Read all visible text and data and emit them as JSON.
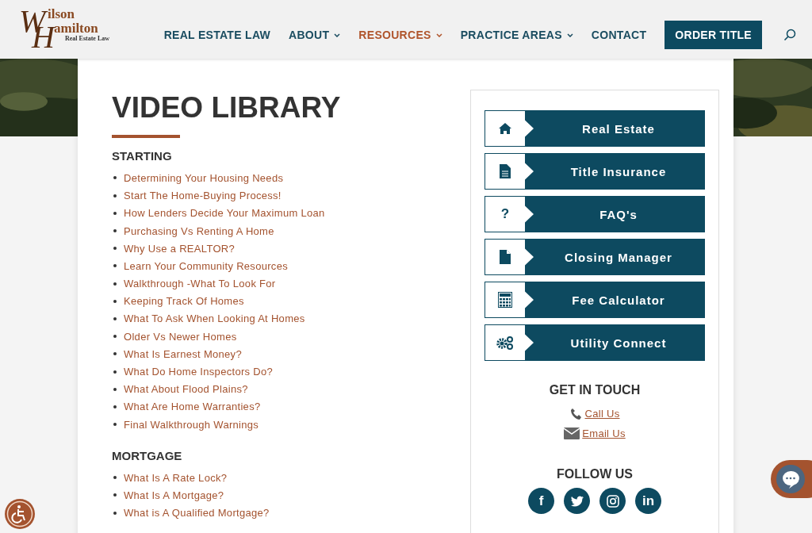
{
  "logo": {
    "initial_1": "W",
    "line_1": "ilson",
    "initial_2": "H",
    "line_2": "amilton",
    "tagline": "Real Estate Law"
  },
  "nav": [
    {
      "label": "REAL ESTATE LAW",
      "dropdown": false,
      "selected": false
    },
    {
      "label": "ABOUT",
      "dropdown": true,
      "selected": false
    },
    {
      "label": "RESOURCES",
      "dropdown": true,
      "selected": true
    },
    {
      "label": "PRACTICE AREAS",
      "dropdown": true,
      "selected": false
    },
    {
      "label": "CONTACT",
      "dropdown": false,
      "selected": false
    }
  ],
  "cta_button": "ORDER TITLE",
  "page_title": "VIDEO LIBRARY",
  "sections": [
    {
      "heading": "STARTING",
      "links": [
        "Determining Your Housing Needs",
        "Start The Home-Buying Process!",
        "How Lenders Decide Your Maximum Loan",
        "Purchasing Vs Renting A Home",
        "Why Use a REALTOR?",
        "Learn Your Community Resources",
        "Walkthrough -What To Look For",
        "Keeping Track Of Homes",
        "What To Ask When Looking At Homes",
        "Older Vs Newer Homes",
        "What Is Earnest Money?",
        "What Do Home Inspectors Do?",
        "What About Flood Plains?",
        "What Are Home Warranties?",
        "Final Walkthrough Warnings"
      ]
    },
    {
      "heading": "MORTGAGE",
      "links": [
        "What Is A Rate Lock?",
        "What Is A Mortgage?",
        "What is A Qualified Mortgage?"
      ]
    }
  ],
  "sidebar_buttons": [
    {
      "label": "Real Estate",
      "kind": "home"
    },
    {
      "label": "Title Insurance",
      "kind": "document"
    },
    {
      "label": "FAQ's",
      "kind": "question",
      "glyph": "?"
    },
    {
      "label": "Closing Manager",
      "kind": "file"
    },
    {
      "label": "Fee Calculator",
      "kind": "calculator"
    },
    {
      "label": "Utility Connect",
      "kind": "gears"
    }
  ],
  "contact": {
    "heading": "GET IN TOUCH",
    "links": [
      {
        "label": "Call Us",
        "kind": "phone"
      },
      {
        "label": "Email Us",
        "kind": "email"
      }
    ]
  },
  "follow": {
    "heading": "FOLLOW US",
    "networks": [
      {
        "kind": "facebook",
        "glyph": "f"
      },
      {
        "kind": "twitter"
      },
      {
        "kind": "instagram"
      },
      {
        "kind": "linkedin",
        "glyph": "in"
      }
    ]
  }
}
